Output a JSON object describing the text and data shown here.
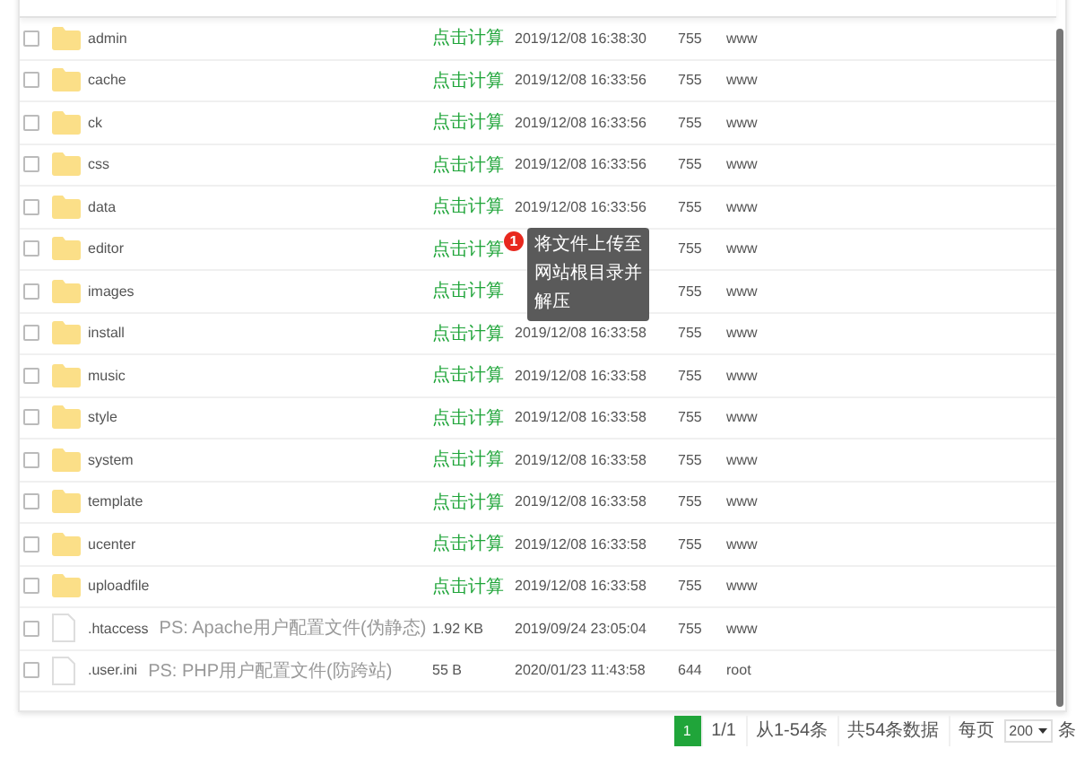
{
  "table": {
    "rows": [
      {
        "kind": "folder",
        "checked": false,
        "name": "admin",
        "size": "点击计算",
        "modified": "2019/12/08 16:38:30",
        "permission": "755",
        "owner": "www"
      },
      {
        "kind": "folder",
        "checked": false,
        "name": "cache",
        "size": "点击计算",
        "modified": "2019/12/08 16:33:56",
        "permission": "755",
        "owner": "www"
      },
      {
        "kind": "folder",
        "checked": false,
        "name": "ck",
        "size": "点击计算",
        "modified": "2019/12/08 16:33:56",
        "permission": "755",
        "owner": "www"
      },
      {
        "kind": "folder",
        "checked": false,
        "name": "css",
        "size": "点击计算",
        "modified": "2019/12/08 16:33:56",
        "permission": "755",
        "owner": "www"
      },
      {
        "kind": "folder",
        "checked": false,
        "name": "data",
        "size": "点击计算",
        "modified": "2019/12/08 16:33:56",
        "permission": "755",
        "owner": "www"
      },
      {
        "kind": "folder",
        "checked": false,
        "name": "editor",
        "size": "点击计算",
        "permission": "755",
        "owner": "www"
      },
      {
        "kind": "folder",
        "checked": false,
        "name": "images",
        "size": "点击计算",
        "permission": "755",
        "owner": "www"
      },
      {
        "kind": "folder",
        "checked": false,
        "name": "install",
        "size": "点击计算",
        "modified": "2019/12/08 16:33:58",
        "permission": "755",
        "owner": "www"
      },
      {
        "kind": "folder",
        "checked": false,
        "name": "music",
        "size": "点击计算",
        "modified": "2019/12/08 16:33:58",
        "permission": "755",
        "owner": "www"
      },
      {
        "kind": "folder",
        "checked": false,
        "name": "style",
        "size": "点击计算",
        "modified": "2019/12/08 16:33:58",
        "permission": "755",
        "owner": "www"
      },
      {
        "kind": "folder",
        "checked": false,
        "name": "system",
        "size": "点击计算",
        "modified": "2019/12/08 16:33:58",
        "permission": "755",
        "owner": "www"
      },
      {
        "kind": "folder",
        "checked": false,
        "name": "template",
        "size": "点击计算",
        "modified": "2019/12/08 16:33:58",
        "permission": "755",
        "owner": "www"
      },
      {
        "kind": "folder",
        "checked": false,
        "name": "ucenter",
        "size": "点击计算",
        "modified": "2019/12/08 16:33:58",
        "permission": "755",
        "owner": "www"
      },
      {
        "kind": "folder",
        "checked": false,
        "name": "uploadfile",
        "size": "点击计算",
        "modified": "2019/12/08 16:33:58",
        "permission": "755",
        "owner": "www"
      },
      {
        "kind": "file",
        "checked": false,
        "name": ".htaccess",
        "remark": "PS: Apache用户配置文件(伪静态)",
        "size": "1.92 KB",
        "modified": "2019/09/24 23:05:04",
        "permission": "755",
        "owner": "www"
      },
      {
        "kind": "file",
        "checked": false,
        "name": ".user.ini",
        "remark": "PS: PHP用户配置文件(防跨站)",
        "size": "55 B",
        "modified": "2020/01/23 11:43:58",
        "permission": "644",
        "owner": "root"
      }
    ]
  },
  "tooltip": {
    "badge": "1",
    "text": "将文件上传至网站根目录并解压"
  },
  "pager": {
    "pages": [
      {
        "label": "1",
        "selected": true
      }
    ],
    "page_count": "1/1",
    "range": "从1-54条",
    "total": "共54条数据",
    "per_page_label": "每页",
    "per_page": "200",
    "per_page_unit": "条"
  }
}
